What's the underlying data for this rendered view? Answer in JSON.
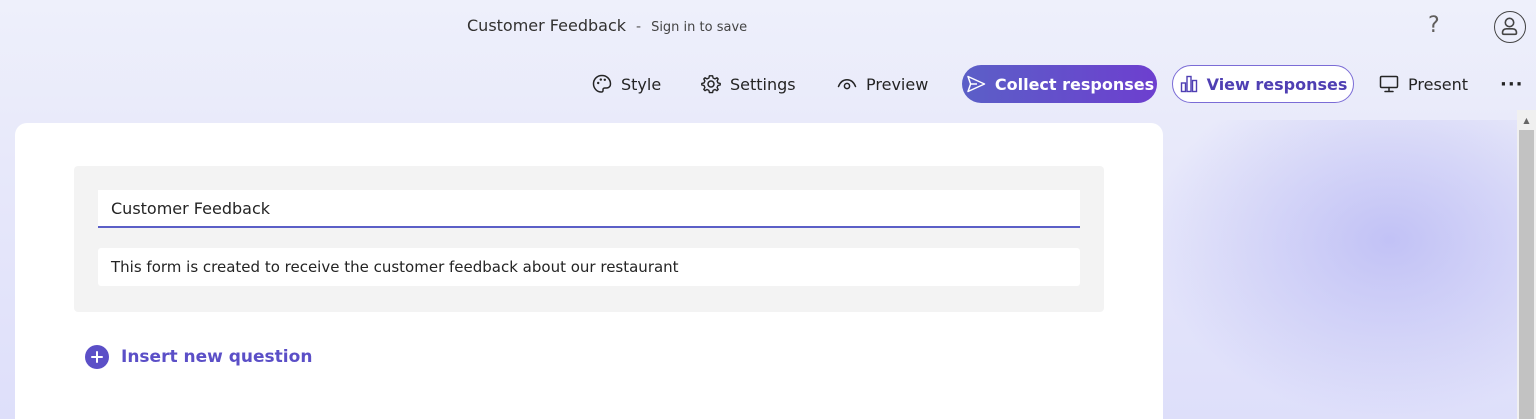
{
  "header": {
    "doc_title": "Customer Feedback",
    "separator": "-",
    "save_hint": "Sign in to save",
    "help_label": "?",
    "avatar_icon": "person-circle-icon"
  },
  "toolbar": {
    "style_label": "Style",
    "settings_label": "Settings",
    "preview_label": "Preview",
    "collect_label": "Collect responses",
    "view_label": "View responses",
    "present_label": "Present",
    "more_label": "···"
  },
  "form": {
    "title": "Customer Feedback",
    "description": "This form is created to receive the customer feedback about our restaurant"
  },
  "actions": {
    "insert_label": "Insert new question"
  },
  "colors": {
    "accent": "#5b5fc7",
    "accent_purple": "#6d3fcf",
    "text": "#242424"
  }
}
